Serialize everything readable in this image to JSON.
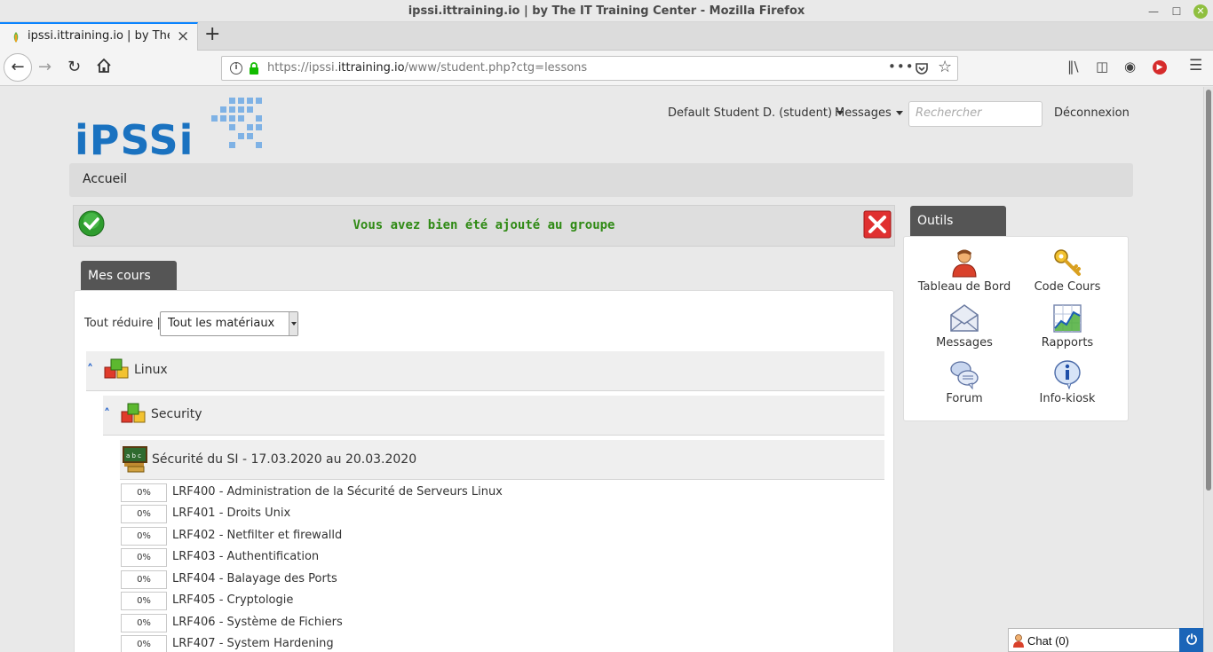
{
  "browser": {
    "window_title": "ipssi.ittraining.io | by The IT Training Center - Mozilla Firefox",
    "tab_title": "ipssi.ittraining.io | by The IT Training Center",
    "url_prefix": "https://ipssi.",
    "url_domain": "ittraining.io",
    "url_path": "/www/student.php?ctg=lessons",
    "page_actions_label": "•••"
  },
  "header": {
    "user_menu": "Default Student D. (student)",
    "messages_menu": "Messages",
    "search_placeholder": "Rechercher",
    "logout": "Déconnexion"
  },
  "breadcrumb": "Accueil",
  "alert": {
    "message": "Vous avez bien été ajouté au groupe",
    "success_color": "#2f8a14"
  },
  "courses": {
    "tab_label": "Mes cours",
    "collapse_all": "Tout réduire",
    "separator": "|",
    "filter_selected": "Tout les matériaux",
    "tree": {
      "category": "Linux",
      "subcategory": "Security",
      "course": "Sécurité du SI - 17.03.2020 au 20.03.2020"
    },
    "lessons": [
      {
        "progress": "0%",
        "label": "LRF400 - Administration de la Sécurité de Serveurs Linux"
      },
      {
        "progress": "0%",
        "label": "LRF401 - Droits Unix"
      },
      {
        "progress": "0%",
        "label": "LRF402 - Netfilter et firewalld"
      },
      {
        "progress": "0%",
        "label": "LRF403 - Authentification"
      },
      {
        "progress": "0%",
        "label": "LRF404 - Balayage des Ports"
      },
      {
        "progress": "0%",
        "label": "LRF405 - Cryptologie"
      },
      {
        "progress": "0%",
        "label": "LRF406 - Système de Fichiers"
      },
      {
        "progress": "0%",
        "label": "LRF407 - System Hardening"
      }
    ]
  },
  "tools": {
    "tab_label": "Outils",
    "items": [
      {
        "label": "Tableau de Bord",
        "icon": "user-icon"
      },
      {
        "label": "Code Cours",
        "icon": "key-icon"
      },
      {
        "label": "Messages",
        "icon": "envelope-icon"
      },
      {
        "label": "Rapports",
        "icon": "chart-icon"
      },
      {
        "label": "Forum",
        "icon": "forum-icon"
      },
      {
        "label": "Info-kiosk",
        "icon": "info-icon"
      }
    ]
  },
  "chat": {
    "label": "Chat (0)"
  }
}
